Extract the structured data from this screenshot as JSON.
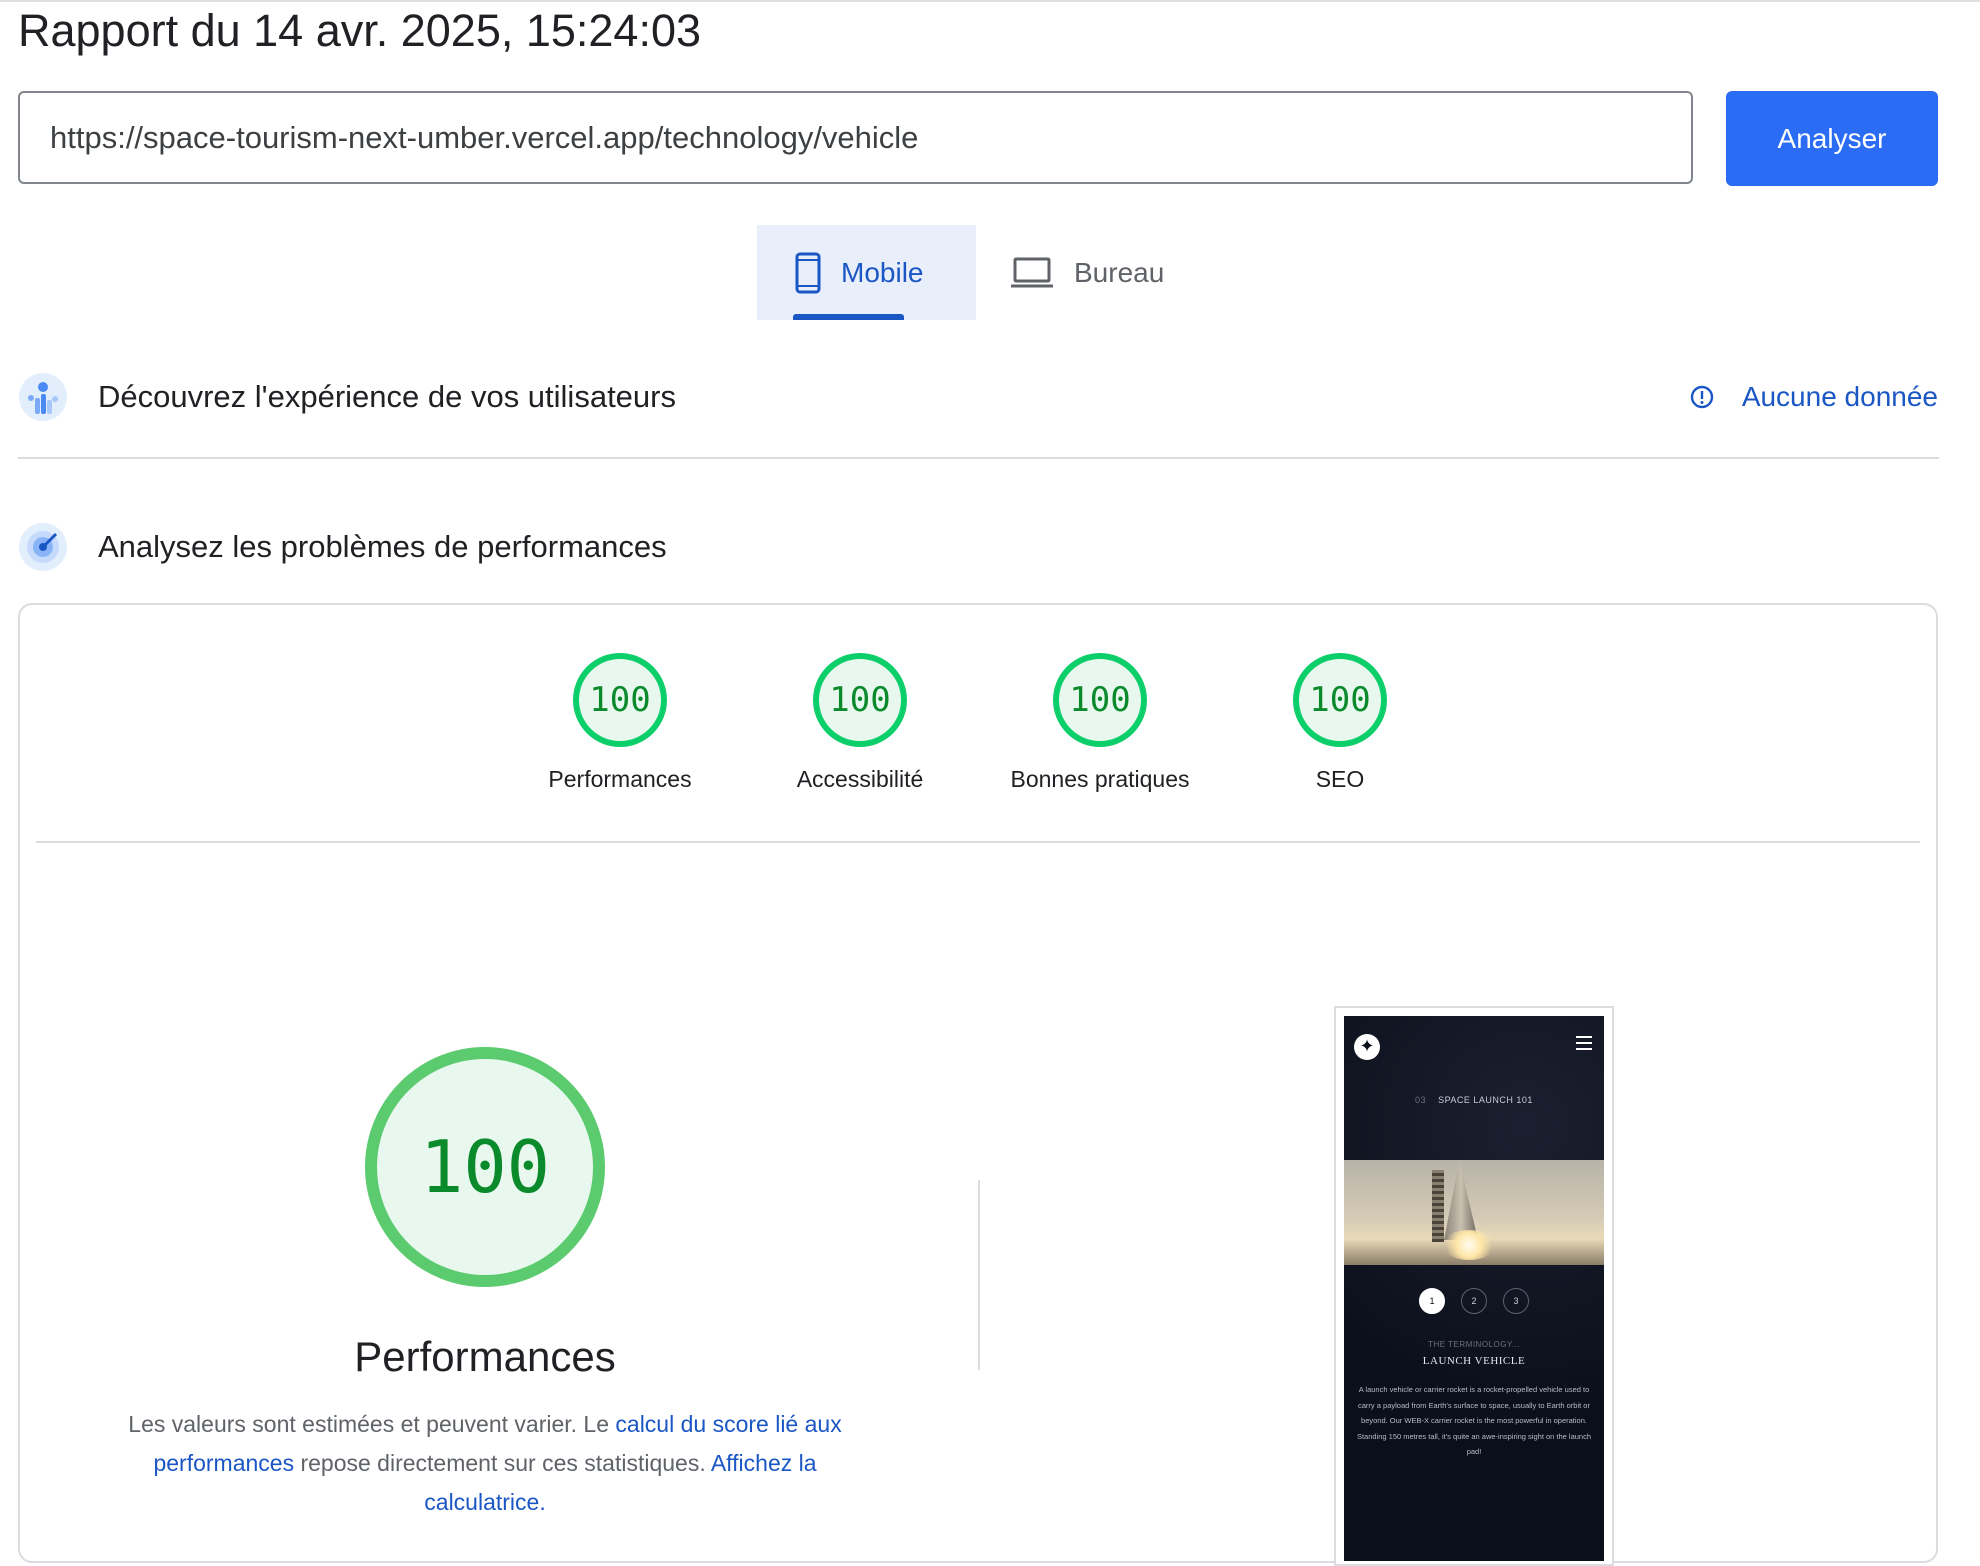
{
  "report": {
    "title": "Rapport du 14 avr. 2025, 15:24:03"
  },
  "search": {
    "url": "https://space-tourism-next-umber.vercel.app/technology/vehicle",
    "analyze_label": "Analyser"
  },
  "tabs": [
    {
      "label": "Mobile",
      "active": true,
      "icon": "smartphone-icon"
    },
    {
      "label": "Bureau",
      "active": false,
      "icon": "laptop-icon"
    }
  ],
  "crux": {
    "title": "Découvrez l'expérience de vos utilisateurs",
    "status": "Aucune donnée"
  },
  "diagnostics": {
    "title": "Analysez les problèmes de performances"
  },
  "scores": [
    {
      "label": "Performances",
      "value": "100"
    },
    {
      "label": "Accessibilité",
      "value": "100"
    },
    {
      "label": "Bonnes pratiques",
      "value": "100"
    },
    {
      "label": "SEO",
      "value": "100"
    }
  ],
  "performance": {
    "score": "100",
    "title": "Performances",
    "desc_1": "Les valeurs sont estimées et peuvent varier. Le ",
    "desc_link_1": "calcul du score lié aux performances",
    "desc_2": " repose directement sur ces statistiques. ",
    "desc_link_2": "Affichez la calculatrice."
  },
  "screenshot": {
    "kicker_num": "03",
    "kicker_text": "SPACE LAUNCH 101",
    "pager": [
      "1",
      "2",
      "3"
    ],
    "terminology": "THE TERMINOLOGY...",
    "heading": "LAUNCH VEHICLE",
    "paragraph": "A launch vehicle or carrier rocket is a rocket-propelled vehicle used to carry a payload from Earth's surface to space, usually to Earth orbit or beyond. Our WEB-X carrier rocket is the most powerful in operation. Standing 150 metres tall, it's quite an awe-inspiring sight on the launch pad!"
  },
  "colors": {
    "accent": "#2a6df4",
    "pass": "#0cce6b",
    "pass_text": "#0a8a2a",
    "link": "#1a56c4"
  }
}
